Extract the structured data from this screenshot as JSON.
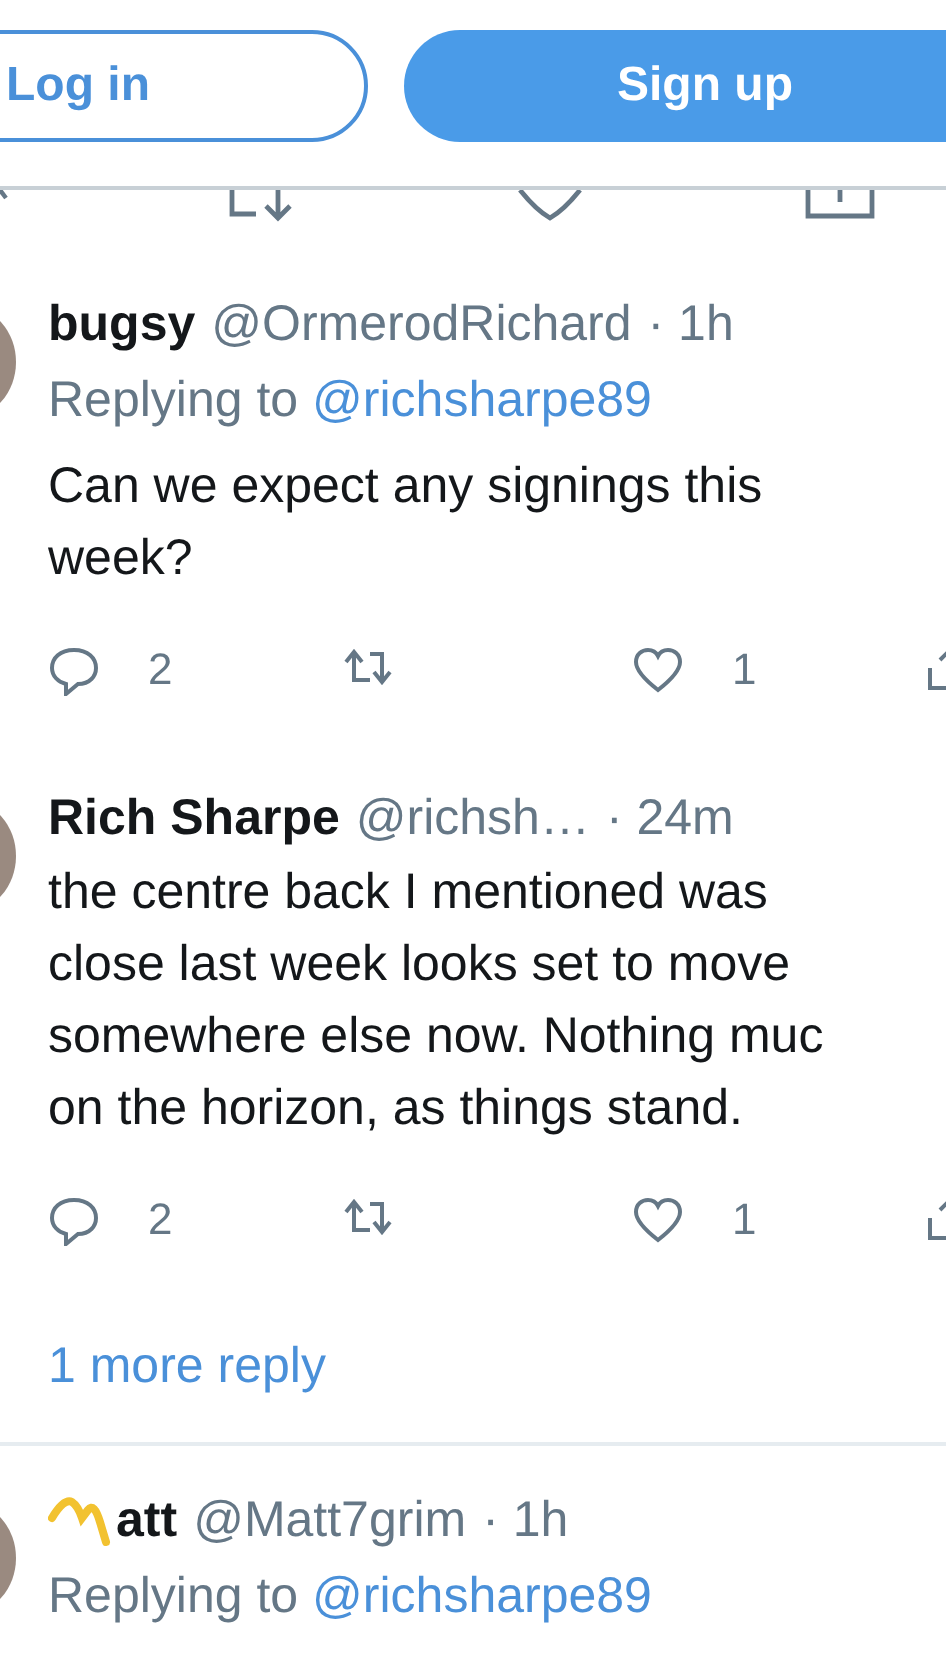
{
  "auth": {
    "login_label": "Log in",
    "signup_label": "Sign up"
  },
  "tweets": [
    {
      "name": "bugsy",
      "name_icon": false,
      "handle": "@OrmerodRichard",
      "time": "· 1h",
      "replying_label": "Replying to",
      "replying_handle": "@richsharpe89",
      "text": "Can we expect any signings this\nweek?",
      "reply_count": "2",
      "like_count": "1"
    },
    {
      "name": "Rich Sharpe",
      "name_icon": false,
      "handle": "@richsh…",
      "time": "· 24m",
      "text": "the centre back I mentioned was\nclose last week looks set to move\nsomewhere else now. Nothing muc\non the horizon, as things stand.",
      "reply_count": "2",
      "like_count": "1",
      "more_replies": "1 more reply"
    },
    {
      "name": "att",
      "name_icon": true,
      "handle": "@Matt7grim",
      "time": "· 1h",
      "replying_label": "Replying to",
      "replying_handle": "@richsharpe89"
    }
  ]
}
